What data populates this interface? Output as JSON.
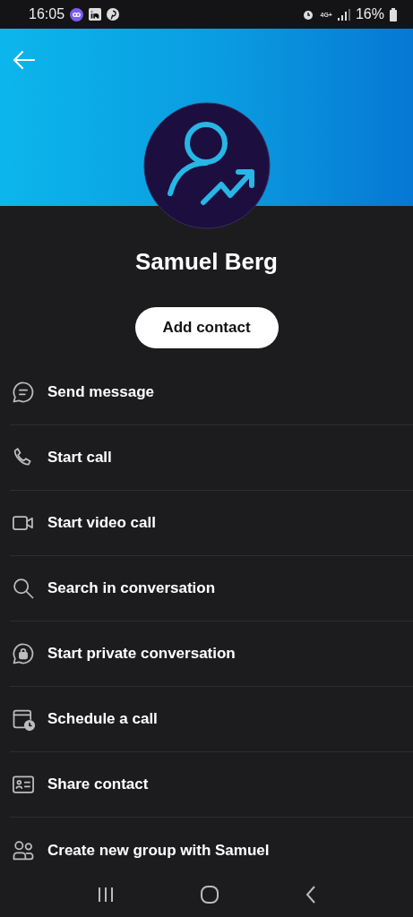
{
  "status_bar": {
    "time": "16:05",
    "network": "4G+",
    "battery": "16%"
  },
  "profile": {
    "name": "Samuel Berg",
    "button": "Add contact"
  },
  "actions": [
    {
      "kind": "message",
      "label": "Send message"
    },
    {
      "kind": "call",
      "label": "Start call"
    },
    {
      "kind": "video",
      "label": "Start video call"
    },
    {
      "kind": "search",
      "label": "Search in conversation"
    },
    {
      "kind": "private",
      "label": "Start private conversation"
    },
    {
      "kind": "schedule",
      "label": "Schedule a call"
    },
    {
      "kind": "share",
      "label": "Share contact"
    },
    {
      "kind": "group",
      "label": "Create new group with Samuel"
    }
  ]
}
